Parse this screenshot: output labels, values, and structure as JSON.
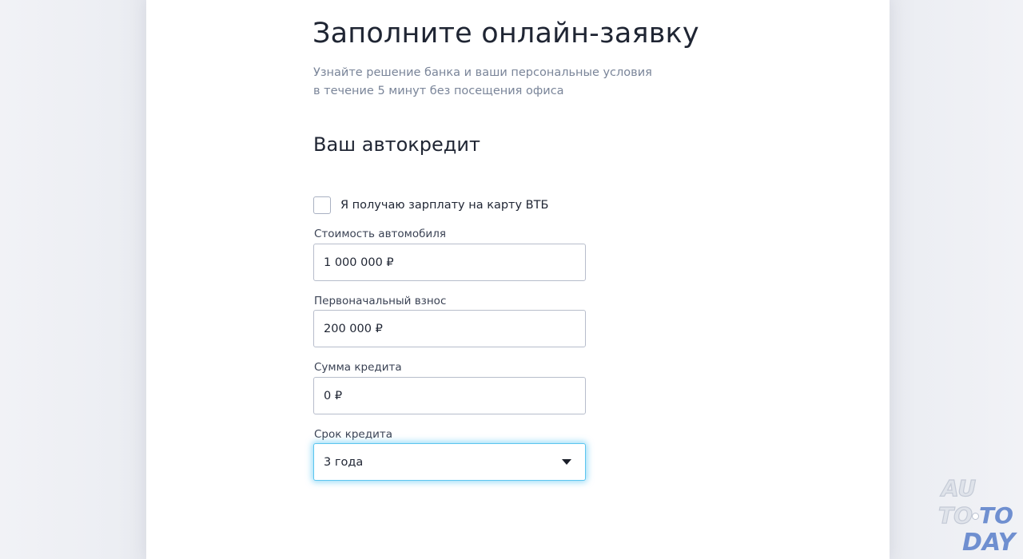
{
  "header": {
    "title": "Заполните онлайн-заявку",
    "subtitle_line1": "Узнайте решение банка и ваши персональные условия",
    "subtitle_line2": "в течение 5 минут без посещения офиса"
  },
  "section": {
    "title": "Ваш автокредит"
  },
  "form": {
    "salary_checkbox": {
      "label": "Я получаю зарплату на карту ВТБ",
      "checked": false
    },
    "car_cost": {
      "label": "Стоимость автомобиля",
      "value": "1 000 000 ₽"
    },
    "down_payment": {
      "label": "Первоначальный взнос",
      "value": "200 000 ₽"
    },
    "loan_amount": {
      "label": "Сумма кредита",
      "value": "0 ₽"
    },
    "loan_term": {
      "label": "Срок кредита",
      "selected": "3 года"
    }
  },
  "watermark": {
    "line1": "AU",
    "line2a": "TO",
    "line2b": "TO",
    "line3": "DAY"
  },
  "colors": {
    "background": "#e9ebf0",
    "card": "#ffffff",
    "text": "#1f2533",
    "muted_text": "#7a8599",
    "input_border": "#b7bdcb",
    "focus_glow": "#5cc5ef",
    "watermark_blue": "#6f8fd0"
  },
  "icons": {
    "select_caret": "caret-down-icon"
  }
}
